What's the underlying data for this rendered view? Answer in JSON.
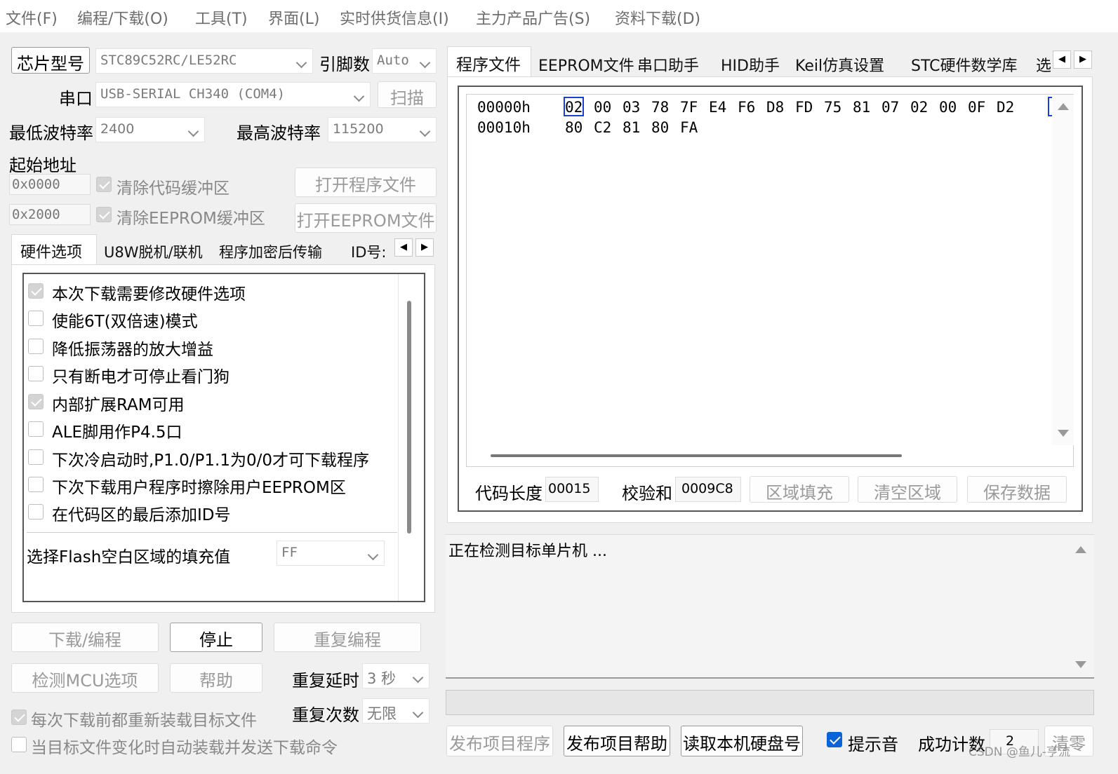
{
  "menu": [
    "文件(F)",
    "编程/下载(O)",
    "工具(T)",
    "界面(L)",
    "实时供货信息(I)",
    "主力产品广告(S)",
    "资料下载(D)"
  ],
  "chip": {
    "button": "芯片型号",
    "value": "STC89C52RC/LE52RC",
    "pin_label": "引脚数",
    "pin_value": "Auto"
  },
  "serial": {
    "label": "串口",
    "value": "USB-SERIAL CH340 (COM4)",
    "scan": "扫描"
  },
  "baud": {
    "min_label": "最低波特率",
    "min_value": "2400",
    "max_label": "最高波特率",
    "max_value": "115200"
  },
  "start": {
    "label": "起始地址",
    "addr1": "0x0000",
    "clear_code": "清除代码缓冲区",
    "addr2": "0x2000",
    "clear_eeprom": "清除EEPROM缓冲区",
    "open_prog": "打开程序文件",
    "open_eeprom": "打开EEPROM文件"
  },
  "left_tabs": [
    "硬件选项",
    "U8W脱机/联机",
    "程序加密后传输",
    "ID号:"
  ],
  "hw_options": [
    {
      "label": "本次下载需要修改硬件选项",
      "checked": true
    },
    {
      "label": "使能6T(双倍速)模式",
      "checked": false
    },
    {
      "label": "降低振荡器的放大增益",
      "checked": false
    },
    {
      "label": "只有断电才可停止看门狗",
      "checked": false
    },
    {
      "label": "内部扩展RAM可用",
      "checked": true
    },
    {
      "label": "ALE脚用作P4.5口",
      "checked": false
    },
    {
      "label": "下次冷启动时,P1.0/P1.1为0/0才可下载程序",
      "checked": false
    },
    {
      "label": "下次下载用户程序时擦除用户EEPROM区",
      "checked": false
    },
    {
      "label": "在代码区的最后添加ID号",
      "checked": false
    }
  ],
  "fill": {
    "label": "选择Flash空白区域的填充值",
    "value": "FF"
  },
  "actions": {
    "download": "下载/编程",
    "stop": "停止",
    "repeat": "重复编程",
    "detect": "检测MCU选项",
    "help": "帮助",
    "delay_label": "重复延时",
    "delay_value": "3 秒",
    "count_label": "重复次数",
    "count_value": "无限"
  },
  "reload": {
    "label": "每次下载前都重新装载目标文件",
    "checked": true
  },
  "auto_send": {
    "label": "当目标文件变化时自动装载并发送下载命令",
    "checked": false
  },
  "right_tabs": [
    "程序文件",
    "EEPROM文件",
    "串口助手",
    "HID助手",
    "Keil仿真设置",
    "STC硬件数学库",
    "选"
  ],
  "hex_rows": [
    {
      "addr": "00000h",
      "bytes": [
        "02",
        "00",
        "03",
        "78",
        "7F",
        "E4",
        "F6",
        "D8",
        "FD",
        "75",
        "81",
        "07",
        "02",
        "00",
        "0F",
        "D2"
      ]
    },
    {
      "addr": "00010h",
      "bytes": [
        "80",
        "C2",
        "81",
        "80",
        "FA"
      ]
    }
  ],
  "code_info": {
    "len_label": "代码长度",
    "len_value": "00015",
    "sum_label": "校验和",
    "sum_value": "0009C8",
    "fill_btn": "区域填充",
    "clear_btn": "清空区域",
    "save_btn": "保存数据"
  },
  "log": "正在检测目标单片机 ...",
  "bottom": {
    "publish_prog": "发布项目程序",
    "publish_help": "发布项目帮助",
    "read_disk": "读取本机硬盘号",
    "sound": "提示音",
    "success_label": "成功计数",
    "success_value": "2",
    "clear": "清零"
  },
  "watermark": "CSDN @鱼儿-亨流"
}
